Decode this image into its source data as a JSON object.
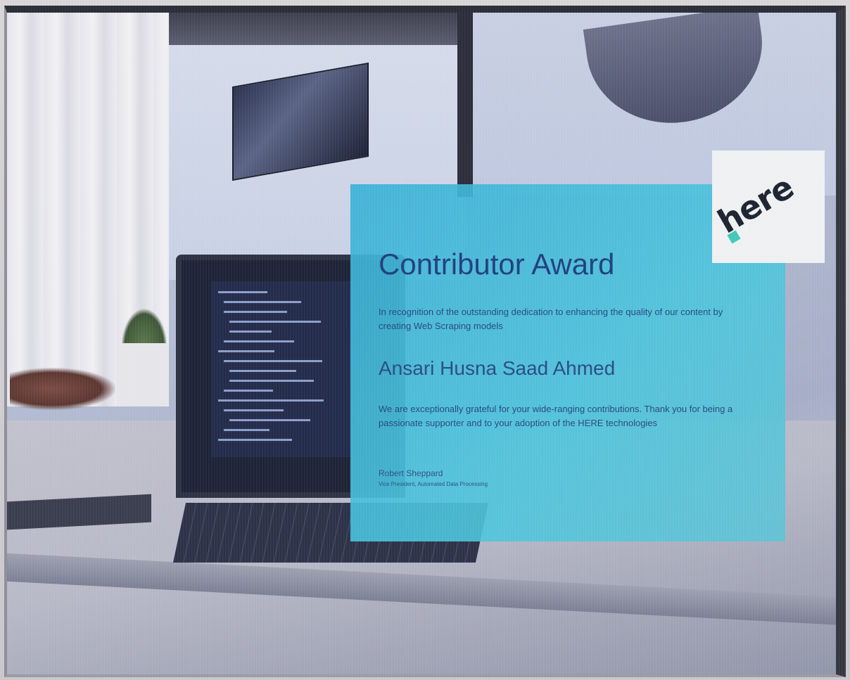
{
  "certificate": {
    "title": "Contributor Award",
    "intro": "In recognition of the outstanding dedication to enhancing the quality of our content by creating Web Scraping models",
    "recipient": "Ansari Husna Saad Ahmed",
    "thanks": "We are exceptionally grateful for your wide-ranging contributions. Thank you for being a passionate supporter and to your adoption of the HERE technologies",
    "signer": "Robert Sheppard",
    "signer_title": "Vice President, Automated Data Processing"
  },
  "logo": {
    "text": "here",
    "accent_color": "#44c7b7"
  },
  "colors": {
    "panel": "#3ab0d6",
    "title": "#1f3f7e",
    "text": "#27497f"
  }
}
